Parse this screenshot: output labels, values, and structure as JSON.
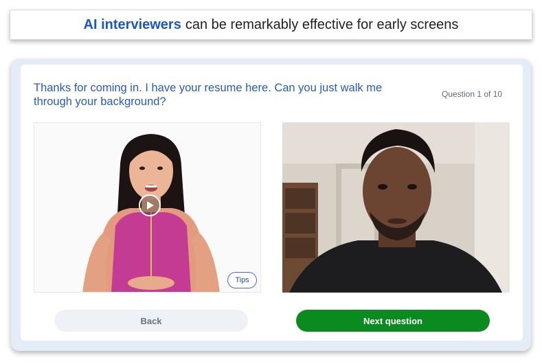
{
  "banner": {
    "highlight": "AI interviewers",
    "text": "can be remarkably effective for early screens"
  },
  "interview": {
    "question": "Thanks for coming in. I have your resume here. Can you just walk me through your background?",
    "counter": "Question 1 of 10"
  },
  "interviewer_video": {
    "tips_label": "Tips",
    "play_icon": "play-icon"
  },
  "candidate_video": {},
  "buttons": {
    "back": "Back",
    "next": "Next question"
  },
  "colors": {
    "accent_blue": "#1a56c4",
    "question_blue": "#2a5bb0",
    "next_green": "#0b8a1f",
    "back_gray": "#eef1f6"
  }
}
